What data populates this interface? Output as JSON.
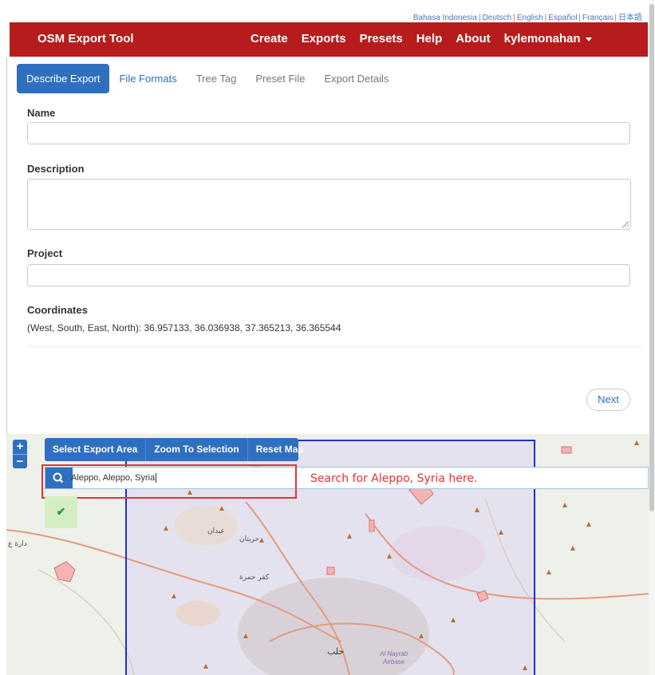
{
  "languages": [
    "Bahasa Indonesia",
    "Deutsch",
    "English",
    "Español",
    "Français",
    "日本語"
  ],
  "navbar": {
    "brand": "OSM Export Tool",
    "links": [
      "Create",
      "Exports",
      "Presets",
      "Help",
      "About"
    ],
    "user": "kylemonahan"
  },
  "tabs": [
    "Describe Export",
    "File Formats",
    "Tree Tag",
    "Preset File",
    "Export Details"
  ],
  "form": {
    "name_label": "Name",
    "name_value": "",
    "description_label": "Description",
    "description_value": "",
    "project_label": "Project",
    "project_value": "",
    "coordinates_label": "Coordinates",
    "coordinates_text": "(West, South, East, North): 36.957133, 36.036938, 37.365213, 36.365544",
    "next_label": "Next"
  },
  "map": {
    "toolbar": [
      "Select Export Area",
      "Zoom To Selection",
      "Reset Map"
    ],
    "zoom_in": "+",
    "zoom_out": "−",
    "search_value": "Aleppo, Aleppo, Syria",
    "annotation": "Search for Aleppo, Syria here.",
    "check_icon": "✔",
    "labels": {
      "town1": "عبدان",
      "town2": "حريتان",
      "town3": "كفر حمرة",
      "city": "حلب",
      "left": "دارة ع",
      "airbase1": "Al Nayrab",
      "airbase2": "Airbase"
    }
  },
  "colors": {
    "navbar": "#b71c1c",
    "primary": "#2f6fc0",
    "annotation": "#e53333",
    "selection_box": "#1a2fd6"
  }
}
